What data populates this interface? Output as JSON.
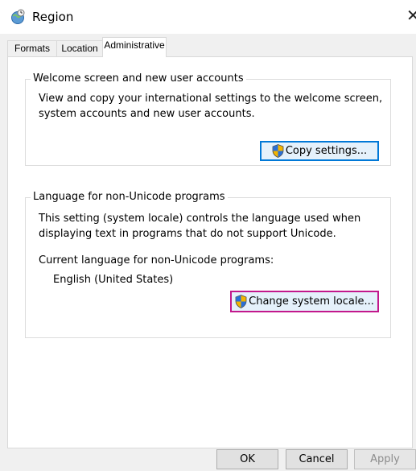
{
  "window": {
    "title": "Region",
    "close_glyph": "✕",
    "icon": "region-clock-globe-icon"
  },
  "tabs": [
    {
      "label": "Formats",
      "active": false
    },
    {
      "label": "Location",
      "active": false
    },
    {
      "label": "Administrative",
      "active": true
    }
  ],
  "welcome_group": {
    "title": "Welcome screen and new user accounts",
    "description": "View and copy your international settings to the welcome screen, system accounts and new user accounts.",
    "button_label": "Copy settings..."
  },
  "unicode_group": {
    "title": "Language for non-Unicode programs",
    "description": "This setting (system locale) controls the language used when displaying text in programs that do not support Unicode.",
    "current_label": "Current language for non-Unicode programs:",
    "current_value": "English (United States)",
    "button_label": "Change system locale..."
  },
  "footer": {
    "ok_label": "OK",
    "cancel_label": "Cancel",
    "apply_label": "Apply"
  },
  "colors": {
    "focus_blue": "#0078d7",
    "highlight_magenta": "#c2188c",
    "dialog_bg": "#f0f0f0"
  }
}
